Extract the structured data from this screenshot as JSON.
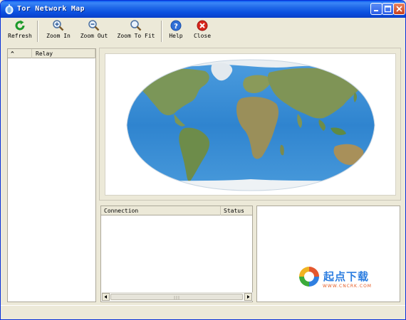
{
  "window": {
    "title": "Tor Network Map"
  },
  "toolbar": {
    "refresh": {
      "label": "Refresh",
      "icon": "refresh-icon"
    },
    "zoom_in": {
      "label": "Zoom In",
      "icon": "zoom-in-icon"
    },
    "zoom_out": {
      "label": "Zoom Out",
      "icon": "zoom-out-icon"
    },
    "zoom_to_fit": {
      "label": "Zoom To Fit",
      "icon": "zoom-to-fit-icon"
    },
    "help": {
      "label": "Help",
      "icon": "help-icon"
    },
    "close": {
      "label": "Close",
      "icon": "close-icon"
    }
  },
  "relay_list": {
    "headers": {
      "sort": "^",
      "relay": "Relay"
    },
    "rows": []
  },
  "connections": {
    "headers": {
      "connection": "Connection",
      "status": "Status"
    },
    "rows": []
  },
  "watermark": {
    "brand": "起点下载",
    "site": "WWW.CNCRK.COM"
  },
  "colors": {
    "title_bar": "#0a4fe0",
    "ocean": "#3a8fd6",
    "land": "#6f8f4f",
    "ice": "#e8eef2"
  }
}
